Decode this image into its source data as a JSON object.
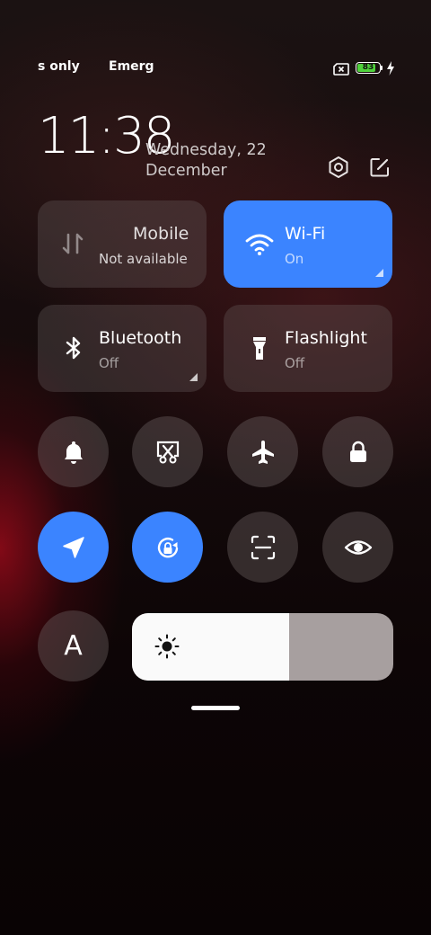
{
  "status_bar": {
    "left_text": "s only",
    "middle_text": "Emerg",
    "battery_level": "83",
    "battery_fraction": 0.83
  },
  "clock": {
    "time": "11:38",
    "date_line1": "Wednesday, 22",
    "date_line2": "December"
  },
  "tiles": {
    "mobile": {
      "title": "Mobile",
      "subtitle": "Not available"
    },
    "wifi": {
      "title": "Wi-Fi",
      "subtitle": "On"
    },
    "bluetooth": {
      "title": "Bluetooth",
      "subtitle": "Off"
    },
    "flashlight": {
      "title": "Flashlight",
      "subtitle": "Off"
    }
  },
  "toggles": {
    "row1": [
      "bell-icon",
      "screenshot-icon",
      "airplane-icon",
      "lock-icon"
    ],
    "row2": [
      "location-icon",
      "rotation-lock-icon",
      "scan-icon",
      "eye-icon"
    ],
    "row3": [
      "font-A-icon"
    ],
    "font_label": "A",
    "active": [
      "location-icon",
      "rotation-lock-icon"
    ]
  },
  "brightness": {
    "level": 0.6
  },
  "colors": {
    "accent": "#3b84ff",
    "tile_dark": "#4a3f3f",
    "battery_green": "#4fd13b"
  }
}
